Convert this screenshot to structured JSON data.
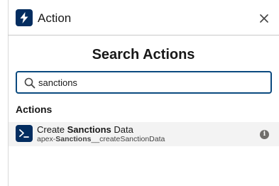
{
  "header": {
    "title": "Action",
    "icon": "lightning-bolt-icon",
    "close_icon": "close-icon"
  },
  "search": {
    "heading": "Search Actions",
    "value": "sanctions",
    "icon": "search-icon"
  },
  "results": {
    "group_label": "Actions",
    "items": [
      {
        "icon": "terminal-prompt-icon",
        "title_before": "Create ",
        "title_match": "Sanctions",
        "title_after": " Data",
        "api_before": "apex-",
        "api_match": "Sanctions",
        "api_after": "__createSanctionData",
        "info_icon": "info-icon"
      }
    ]
  },
  "colors": {
    "brand_navy": "#032d60",
    "focus_border": "#0b4a7f",
    "row_highlight": "#f3f3f3"
  }
}
